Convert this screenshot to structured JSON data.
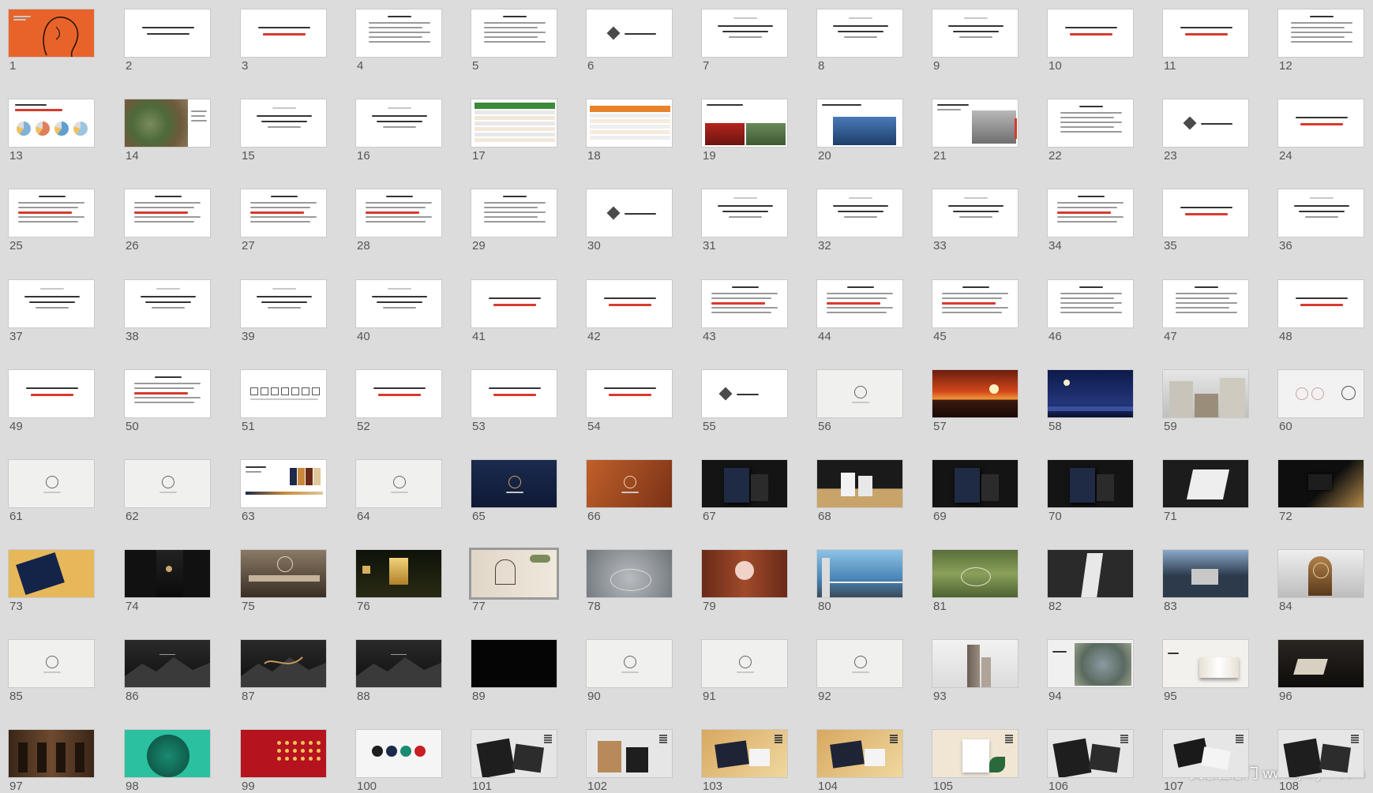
{
  "sorter": {
    "columns": 12,
    "selected_slide": 77,
    "watermark": "灵感狂意门 www.yxrym.com"
  },
  "colors": {
    "background": "#dcdcdc",
    "thumb_border": "#c9c9c9",
    "selected_border": "#9a9a9a",
    "accent_red": "#d83a2e",
    "accent_orange": "#e8632a"
  },
  "slides": [
    {
      "n": "1",
      "kind": "orange-portrait"
    },
    {
      "n": "2",
      "kind": "title",
      "red": false
    },
    {
      "n": "3",
      "kind": "title",
      "red": true
    },
    {
      "n": "4",
      "kind": "list"
    },
    {
      "n": "5",
      "kind": "list"
    },
    {
      "n": "6",
      "kind": "diamond"
    },
    {
      "n": "7",
      "kind": "title-bold"
    },
    {
      "n": "8",
      "kind": "title-bold"
    },
    {
      "n": "9",
      "kind": "title-bold"
    },
    {
      "n": "10",
      "kind": "title",
      "red": true
    },
    {
      "n": "11",
      "kind": "title",
      "red": true
    },
    {
      "n": "12",
      "kind": "list"
    },
    {
      "n": "13",
      "kind": "pies"
    },
    {
      "n": "14",
      "kind": "map"
    },
    {
      "n": "15",
      "kind": "title-bold"
    },
    {
      "n": "16",
      "kind": "title-bold"
    },
    {
      "n": "17",
      "kind": "table-green"
    },
    {
      "n": "18",
      "kind": "table-orange"
    },
    {
      "n": "19",
      "kind": "photo-red"
    },
    {
      "n": "20",
      "kind": "photo-blue"
    },
    {
      "n": "21",
      "kind": "photo-city"
    },
    {
      "n": "22",
      "kind": "list"
    },
    {
      "n": "23",
      "kind": "diamond"
    },
    {
      "n": "24",
      "kind": "title",
      "red": true
    },
    {
      "n": "25",
      "kind": "list-red"
    },
    {
      "n": "26",
      "kind": "list-red"
    },
    {
      "n": "27",
      "kind": "list-red"
    },
    {
      "n": "28",
      "kind": "list-red"
    },
    {
      "n": "29",
      "kind": "list"
    },
    {
      "n": "30",
      "kind": "diamond"
    },
    {
      "n": "31",
      "kind": "title-bold"
    },
    {
      "n": "32",
      "kind": "title-bold"
    },
    {
      "n": "33",
      "kind": "title-bold"
    },
    {
      "n": "34",
      "kind": "list-red"
    },
    {
      "n": "35",
      "kind": "title",
      "red": true
    },
    {
      "n": "36",
      "kind": "title-bold"
    },
    {
      "n": "37",
      "kind": "title-bold"
    },
    {
      "n": "38",
      "kind": "title-bold"
    },
    {
      "n": "39",
      "kind": "title-bold"
    },
    {
      "n": "40",
      "kind": "title-bold"
    },
    {
      "n": "41",
      "kind": "title",
      "red": true
    },
    {
      "n": "42",
      "kind": "title",
      "red": true
    },
    {
      "n": "43",
      "kind": "list-red"
    },
    {
      "n": "44",
      "kind": "list-red"
    },
    {
      "n": "45",
      "kind": "list-red"
    },
    {
      "n": "46",
      "kind": "list"
    },
    {
      "n": "47",
      "kind": "list"
    },
    {
      "n": "48",
      "kind": "title",
      "red": true
    },
    {
      "n": "49",
      "kind": "title",
      "red": true
    },
    {
      "n": "50",
      "kind": "list-red"
    },
    {
      "n": "51",
      "kind": "icons-row"
    },
    {
      "n": "52",
      "kind": "title",
      "red": true
    },
    {
      "n": "53",
      "kind": "title",
      "red": true
    },
    {
      "n": "54",
      "kind": "title",
      "red": true
    },
    {
      "n": "55",
      "kind": "diamond-show"
    },
    {
      "n": "56",
      "kind": "grey-logo"
    },
    {
      "n": "57",
      "kind": "sunset"
    },
    {
      "n": "58",
      "kind": "night"
    },
    {
      "n": "59",
      "kind": "building"
    },
    {
      "n": "60",
      "kind": "circles-light"
    },
    {
      "n": "61",
      "kind": "grey-logo"
    },
    {
      "n": "62",
      "kind": "grey-logo"
    },
    {
      "n": "63",
      "kind": "palette"
    },
    {
      "n": "64",
      "kind": "grey-logo"
    },
    {
      "n": "65",
      "kind": "navy-logo"
    },
    {
      "n": "66",
      "kind": "copper-logo"
    },
    {
      "n": "67",
      "kind": "dark-card"
    },
    {
      "n": "68",
      "kind": "dark-card-gold"
    },
    {
      "n": "69",
      "kind": "dark-card"
    },
    {
      "n": "70",
      "kind": "dark-card"
    },
    {
      "n": "71",
      "kind": "dark-paper"
    },
    {
      "n": "72",
      "kind": "dark-gold"
    },
    {
      "n": "73",
      "kind": "gold-navy"
    },
    {
      "n": "74",
      "kind": "suit"
    },
    {
      "n": "75",
      "kind": "interior"
    },
    {
      "n": "76",
      "kind": "lantern"
    },
    {
      "n": "77",
      "kind": "wall-emblem"
    },
    {
      "n": "78",
      "kind": "stone"
    },
    {
      "n": "79",
      "kind": "wood-door"
    },
    {
      "n": "80",
      "kind": "balcony"
    },
    {
      "n": "81",
      "kind": "garden"
    },
    {
      "n": "82",
      "kind": "pillar"
    },
    {
      "n": "83",
      "kind": "emblem-wall"
    },
    {
      "n": "84",
      "kind": "bronze"
    },
    {
      "n": "85",
      "kind": "grey-logo"
    },
    {
      "n": "86",
      "kind": "black-mountain"
    },
    {
      "n": "87",
      "kind": "black-mountain-gold"
    },
    {
      "n": "88",
      "kind": "black-mountain"
    },
    {
      "n": "89",
      "kind": "black"
    },
    {
      "n": "90",
      "kind": "grey-logo"
    },
    {
      "n": "91",
      "kind": "grey-logo"
    },
    {
      "n": "92",
      "kind": "grey-logo"
    },
    {
      "n": "93",
      "kind": "tower"
    },
    {
      "n": "94",
      "kind": "aerial"
    },
    {
      "n": "95",
      "kind": "book"
    },
    {
      "n": "96",
      "kind": "dark-lobby"
    },
    {
      "n": "97",
      "kind": "lobby-wood"
    },
    {
      "n": "98",
      "kind": "jade"
    },
    {
      "n": "99",
      "kind": "red-pattern"
    },
    {
      "n": "100",
      "kind": "color-dots"
    },
    {
      "n": "101",
      "kind": "stationery-dark"
    },
    {
      "n": "102",
      "kind": "bags-kraft"
    },
    {
      "n": "103",
      "kind": "stationery-gold"
    },
    {
      "n": "104",
      "kind": "stationery-gold"
    },
    {
      "n": "105",
      "kind": "bag-white"
    },
    {
      "n": "106",
      "kind": "stationery-dark"
    },
    {
      "n": "107",
      "kind": "stationery-mixed"
    },
    {
      "n": "108",
      "kind": "stationery-dark"
    }
  ]
}
